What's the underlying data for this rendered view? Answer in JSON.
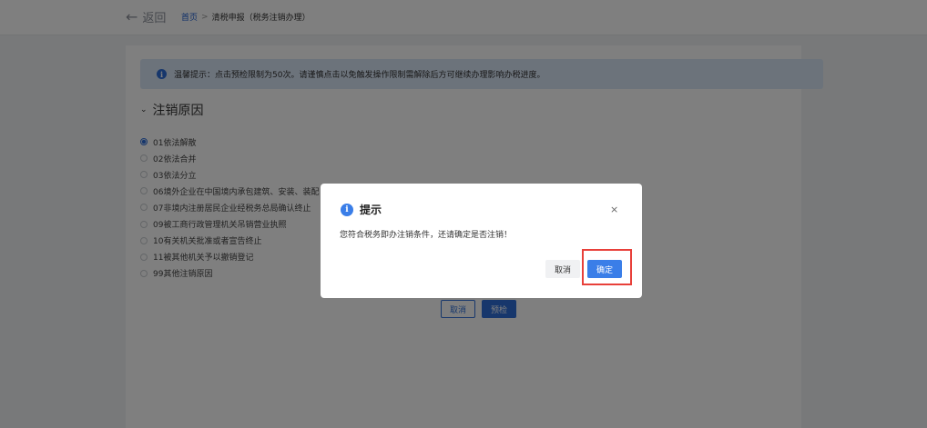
{
  "header": {
    "back_label": "返回",
    "breadcrumb_home": "首页",
    "breadcrumb_sep": ">",
    "breadcrumb_current": "清税申报（税务注销办理）"
  },
  "notice": {
    "text": "温馨提示：点击预检限制为50次。请谨慎点击以免触发操作限制需解除后方可继续办理影响办税进度。"
  },
  "section": {
    "title": "注销原因"
  },
  "reasons": [
    {
      "label": "01依法解散",
      "selected": true
    },
    {
      "label": "02依法合并",
      "selected": false
    },
    {
      "label": "03依法分立",
      "selected": false
    },
    {
      "label": "06境外企业在中国境内承包建筑、安装、装配",
      "selected": false
    },
    {
      "label": "07非境内注册居民企业经税务总局确认终止",
      "selected": false
    },
    {
      "label": "09被工商行政管理机关吊销营业执照",
      "selected": false
    },
    {
      "label": "10有关机关批准或者宣告终止",
      "selected": false
    },
    {
      "label": "11被其他机关予以撤销登记",
      "selected": false
    },
    {
      "label": "99其他注销原因",
      "selected": false
    }
  ],
  "actions": {
    "cancel_label": "取消",
    "precheck_label": "预检"
  },
  "dialog": {
    "title": "提示",
    "close_symbol": "×",
    "message": "您符合税务即办注销条件，还请确定是否注销！",
    "cancel_label": "取消",
    "confirm_label": "确定"
  },
  "colors": {
    "primary": "#2e6fd8",
    "notice_bg": "#d9e6f7",
    "highlight": "#e8403a",
    "overlay": "rgba(0,0,0,0.5)"
  },
  "icons": {
    "back": "arrow-left-icon",
    "notice": "info-icon",
    "collapse": "chevron-down-icon",
    "dialog": "info-icon",
    "close": "close-icon"
  }
}
